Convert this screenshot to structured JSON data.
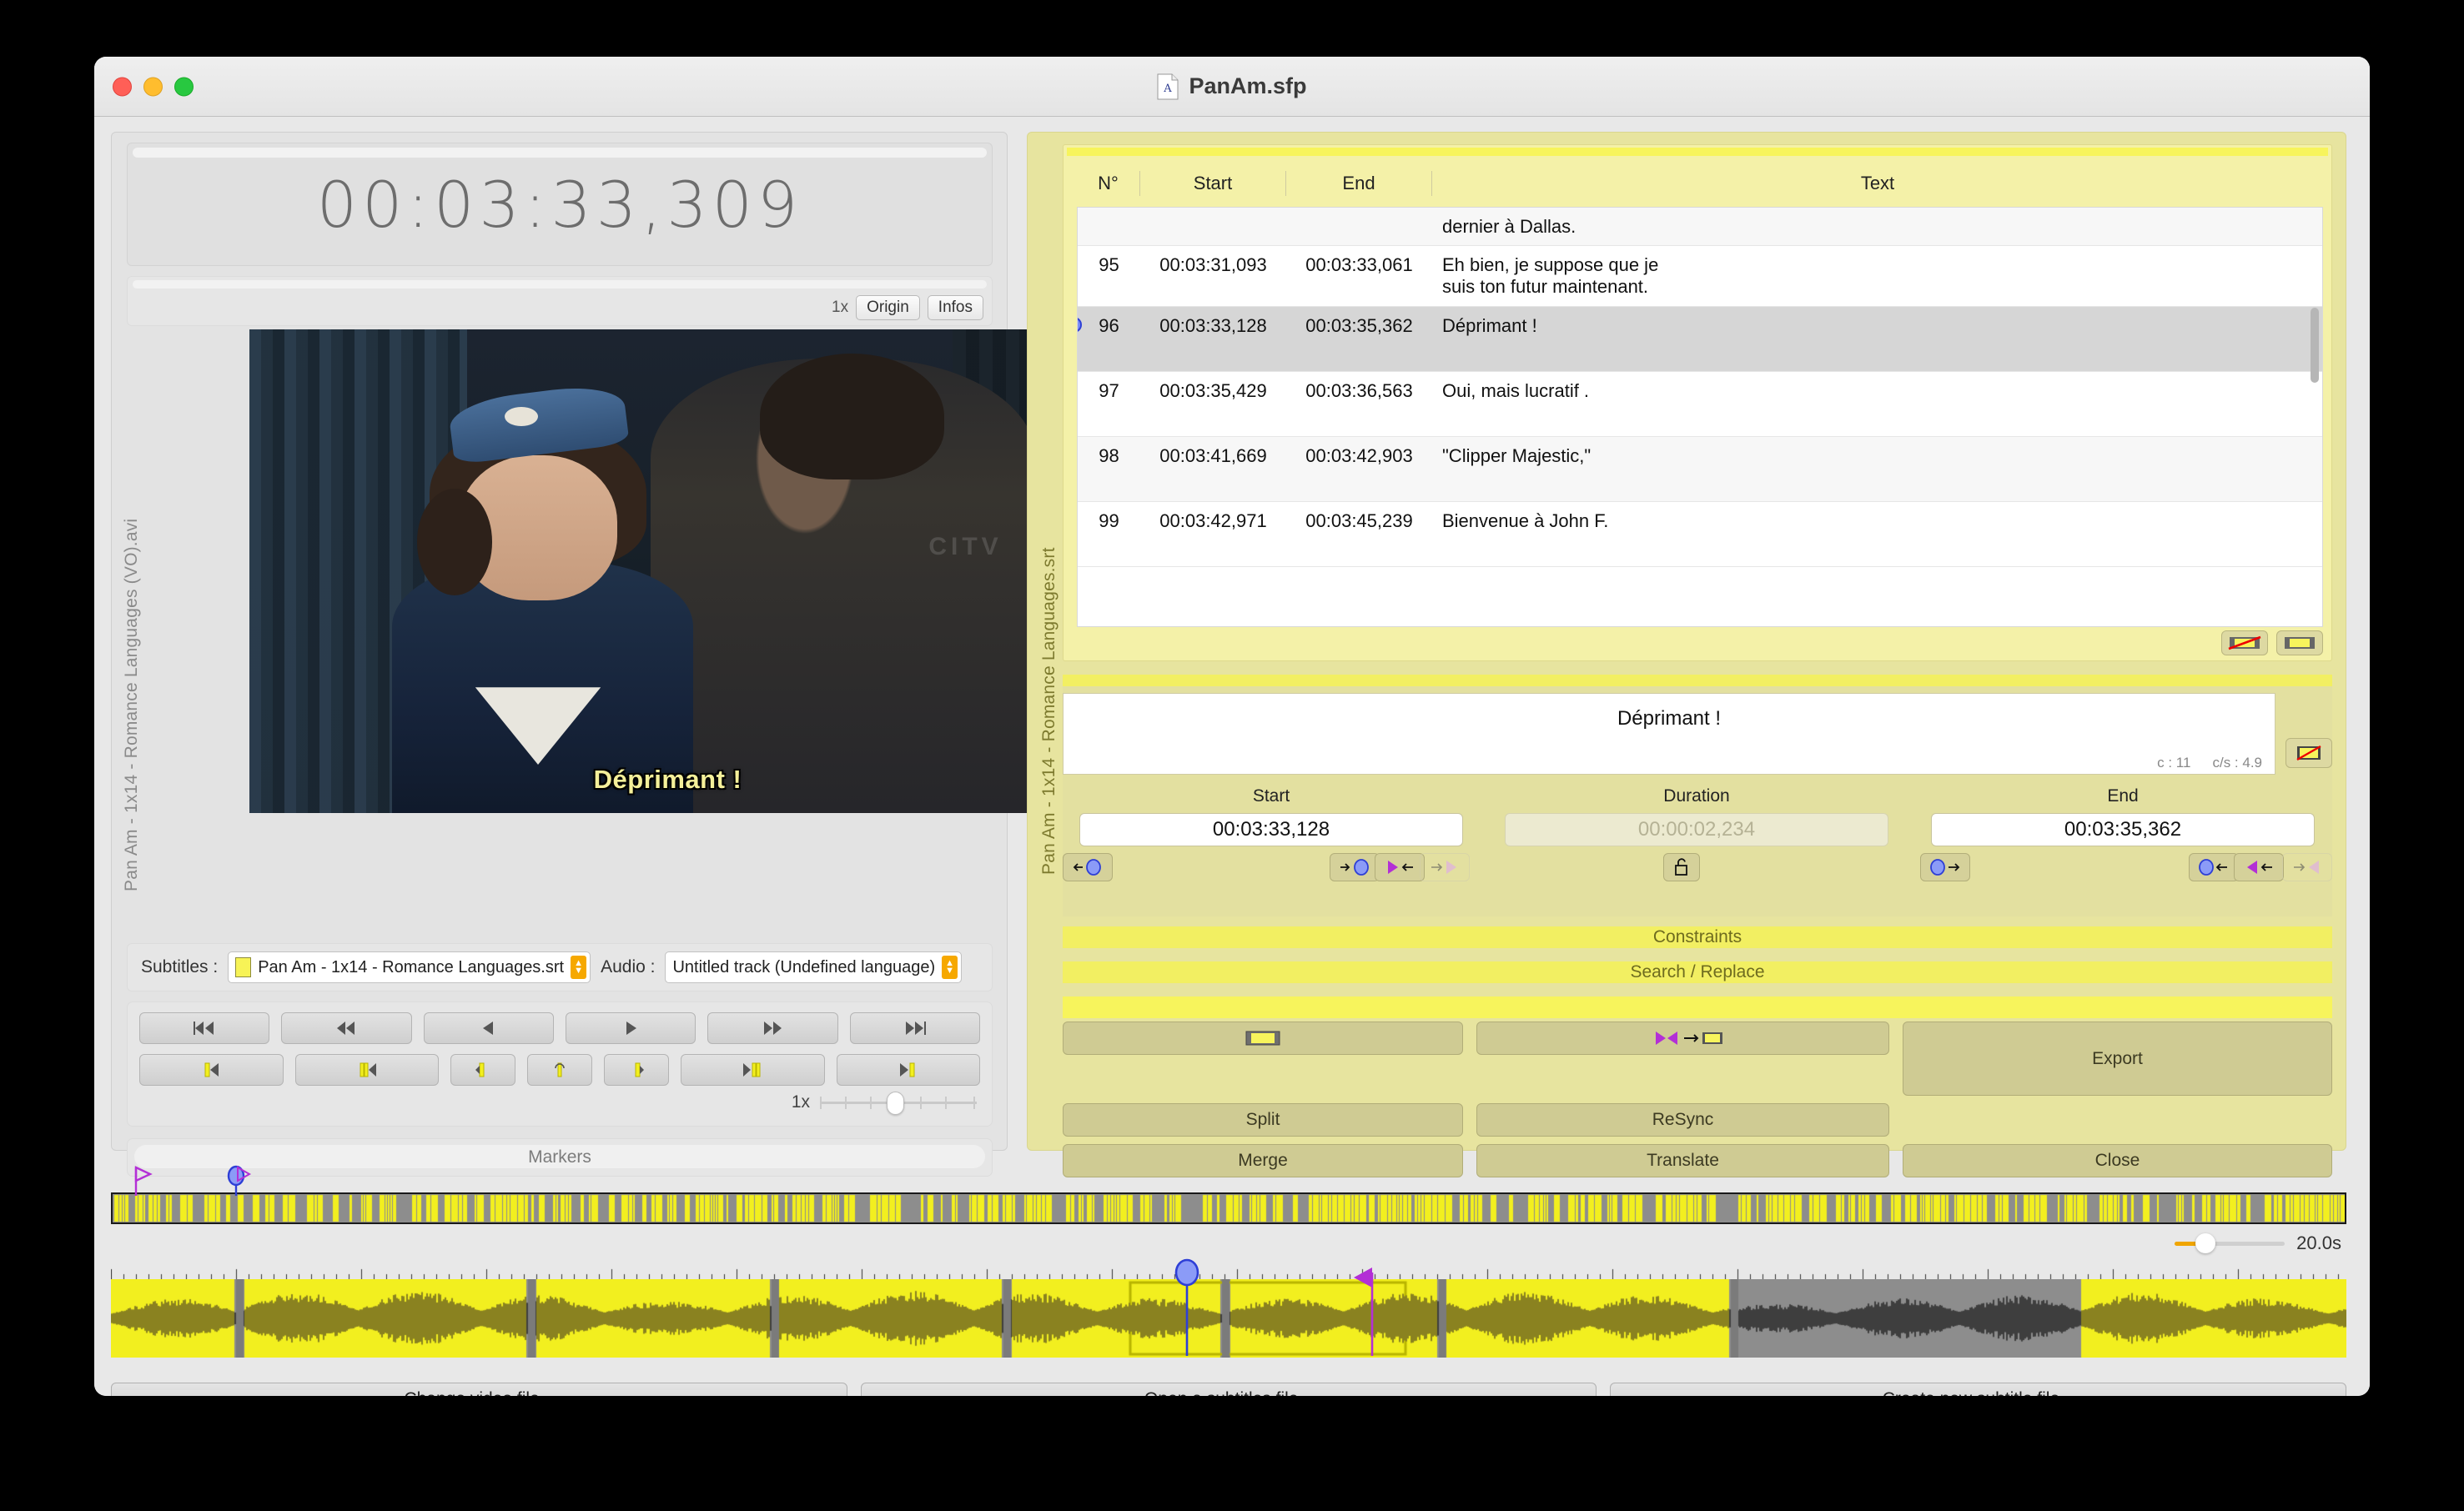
{
  "window": {
    "title": "PanAm.sfp",
    "doc_icon": "document-icon"
  },
  "left": {
    "video_file_label": "Pan Am - 1x14 - Romance Languages (VO).avi",
    "timecode": "00:03:33,309",
    "speed_badge": "1x",
    "origin_button": "Origin",
    "infos_button": "Infos",
    "video_subtitle": "Déprimant !",
    "video_watermark": "CITV",
    "subtitles_label": "Subtitles :",
    "subtitles_value": "Pan Am - 1x14 - Romance Languages.srt",
    "audio_label": "Audio :",
    "audio_value": "Untitled track (Undefined language)",
    "transport_row1": [
      "skip-to-start-icon",
      "rewind-fast-icon",
      "step-back-icon",
      "play-icon",
      "forward-fast-icon",
      "skip-to-end-icon"
    ],
    "transport_row2": [
      "prev-subtitle-start-icon",
      "prev-subtitle-icon",
      "subtitle-in-icon",
      "loop-subtitle-icon",
      "subtitle-out-icon",
      "next-subtitle-icon",
      "next-subtitle-end-icon"
    ],
    "speed_slider_label": "1x",
    "markers_label": "Markers"
  },
  "right": {
    "subtitle_file_label": "Pan Am - 1x14 - Romance Languages.srt",
    "table": {
      "columns": [
        "N°",
        "Start",
        "End",
        "Text"
      ],
      "rows": [
        {
          "n": "",
          "start": "",
          "end": "",
          "text": "dernier à Dallas.",
          "selected": false,
          "partial": true
        },
        {
          "n": "95",
          "start": "00:03:31,093",
          "end": "00:03:33,061",
          "text": "Eh bien, je suppose que je\nsuis ton futur maintenant.",
          "selected": false
        },
        {
          "n": "96",
          "start": "00:03:33,128",
          "end": "00:03:35,362",
          "text": "Déprimant !",
          "selected": true
        },
        {
          "n": "97",
          "start": "00:03:35,429",
          "end": "00:03:36,563",
          "text": "Oui, mais lucratif .",
          "selected": false
        },
        {
          "n": "98",
          "start": "00:03:41,669",
          "end": "00:03:42,903",
          "text": "\"Clipper Majestic,\"",
          "selected": false
        },
        {
          "n": "99",
          "start": "00:03:42,971",
          "end": "00:03:45,239",
          "text": "Bienvenue à John F.",
          "selected": false
        }
      ]
    },
    "table_tools": [
      "subtitle-disabled-icon",
      "subtitle-enabled-icon"
    ],
    "editor": {
      "text": "Déprimant !",
      "chars_label": "c : 11",
      "cps_label": "c/s : 4.9",
      "warning_icon": "subtitle-warning-icon",
      "start_label": "Start",
      "duration_label": "Duration",
      "end_label": "End",
      "start_value": "00:03:33,128",
      "duration_value": "00:00:02,234",
      "end_value": "00:03:35,362",
      "lock_icon": "unlock-icon"
    },
    "constraints_label": "Constraints",
    "search_replace_label": "Search / Replace",
    "actions": {
      "adjust_icon": "adjust-subtitle-icon",
      "snap_icon": "snap-to-shot-icon",
      "split": "Split",
      "resync": "ReSync",
      "export": "Export",
      "merge": "Merge",
      "translate": "Translate",
      "close": "Close"
    }
  },
  "timeline": {
    "zoom_value": "20.0s",
    "playhead_icon": "playhead-marker-icon",
    "flag_icon": "flag-marker-icon"
  },
  "bottom": {
    "change_video": "Change video file...",
    "open_subtitles": "Open a subtitles file...",
    "create_subtitle": "Create new subtitle file..."
  },
  "colors": {
    "panel_yellow": "#e7e49f",
    "bright_yellow": "#f7f45c",
    "waveform_yellow": "#f2ef1f",
    "accent_orange": "#f0a500",
    "marker_blue": "#3b4fe0",
    "marker_purple": "#b32fd6"
  }
}
